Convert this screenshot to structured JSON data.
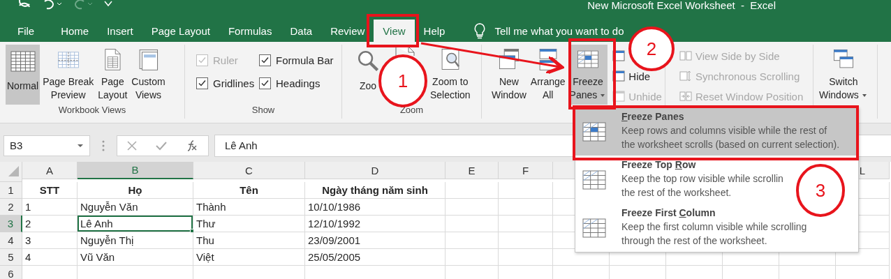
{
  "title_bar": {
    "title": "New Microsoft Excel Worksheet  -  Excel"
  },
  "tabs": [
    {
      "label": "File",
      "selected": false
    },
    {
      "label": "Home",
      "selected": false
    },
    {
      "label": "Insert",
      "selected": false
    },
    {
      "label": "Page Layout",
      "selected": false
    },
    {
      "label": "Formulas",
      "selected": false
    },
    {
      "label": "Data",
      "selected": false
    },
    {
      "label": "Review",
      "selected": false
    },
    {
      "label": "View",
      "selected": true
    },
    {
      "label": "Help",
      "selected": false
    }
  ],
  "tell_me": {
    "text": "Tell me what you want to do"
  },
  "workbook_views": {
    "label": "Workbook Views",
    "buttons": [
      {
        "label": "Normal",
        "selected": true
      },
      {
        "label": "Page Break\nPreview",
        "selected": false
      },
      {
        "label": "Page\nLayout",
        "selected": false
      },
      {
        "label": "Custom\nViews",
        "selected": false
      }
    ]
  },
  "show": {
    "label": "Show",
    "items": [
      {
        "label": "Ruler",
        "checked": true,
        "disabled": true
      },
      {
        "label": "Formula Bar",
        "checked": true,
        "disabled": false
      },
      {
        "label": "Gridlines",
        "checked": true,
        "disabled": false
      },
      {
        "label": "Headings",
        "checked": true,
        "disabled": false
      }
    ]
  },
  "zoom": {
    "label": "Zoom",
    "buttons": [
      {
        "label": "Zoo"
      },
      {
        "label": "Zoom to\nSelection"
      }
    ]
  },
  "window": {
    "buttons": [
      {
        "label": "New\nWindow",
        "selected": false,
        "dropdown": false
      },
      {
        "label": "Arrange\nAll",
        "selected": false,
        "dropdown": false
      },
      {
        "label": "Freeze\nPanes",
        "selected": true,
        "dropdown": true
      }
    ],
    "small": [
      {
        "label": "Hide",
        "disabled": false
      },
      {
        "label": "Unhide",
        "disabled": true
      }
    ],
    "compare": [
      {
        "label": "View Side by Side",
        "disabled": true
      },
      {
        "label": "Synchronous Scrolling",
        "disabled": true
      },
      {
        "label": "Reset Window Position",
        "disabled": true
      }
    ],
    "switch": {
      "label": "Switch\nWindows",
      "dropdown": true
    }
  },
  "formula_bar": {
    "name_box": "B3",
    "value": "Lê Anh"
  },
  "sheet": {
    "columns": [
      {
        "label": "A",
        "selected": false
      },
      {
        "label": "B",
        "selected": true
      },
      {
        "label": "C",
        "selected": false
      },
      {
        "label": "D",
        "selected": false
      },
      {
        "label": "E",
        "selected": false
      },
      {
        "label": "F",
        "selected": false
      }
    ],
    "far_columns": [
      {
        "label": "L",
        "selected": false
      }
    ],
    "rows": [
      {
        "header": "1",
        "selected": false,
        "kind": "header",
        "cells": [
          "STT",
          "Họ",
          "Tên",
          "Ngày tháng năm sinh"
        ]
      },
      {
        "header": "2",
        "selected": false,
        "kind": "data",
        "cells": [
          "1",
          "Nguyễn Văn",
          "Thành",
          "10/10/1986"
        ]
      },
      {
        "header": "3",
        "selected": true,
        "kind": "data",
        "cells": [
          "2",
          "Lê Anh",
          "Thư",
          "12/10/1992"
        ]
      },
      {
        "header": "4",
        "selected": false,
        "kind": "data",
        "cells": [
          "3",
          "Nguyễn Thị",
          "Thu",
          "23/09/2001"
        ]
      },
      {
        "header": "5",
        "selected": false,
        "kind": "data",
        "cells": [
          "4",
          "Vũ Văn",
          "Việt",
          "25/05/2005"
        ]
      },
      {
        "header": "6",
        "selected": false,
        "kind": "data"
      }
    ]
  },
  "menu": {
    "items": [
      {
        "title": {
          "key": "F",
          "rest": "reeze Panes"
        },
        "description": "Keep rows and columns visible while the rest of\nthe worksheet scrolls (based on current selection).",
        "selected": true
      },
      {
        "title": {
          "pre": "Freeze Top ",
          "key": "R",
          "rest": "ow"
        },
        "description": "Keep the top row visible while scrollin\nthe rest of the worksheet.",
        "selected": false
      },
      {
        "title": {
          "pre": "Freeze First ",
          "key": "C",
          "rest": "olumn"
        },
        "description": "Keep the first column visible while scrolling\nthrough the rest of the worksheet.",
        "selected": false
      }
    ]
  },
  "annotations": [
    {
      "kind": "box"
    },
    {
      "kind": "box"
    },
    {
      "kind": "box"
    },
    {
      "kind": "arrow"
    },
    {
      "kind": "circle",
      "label": "1"
    },
    {
      "kind": "circle",
      "label": "2"
    },
    {
      "kind": "circle",
      "label": "3"
    }
  ]
}
